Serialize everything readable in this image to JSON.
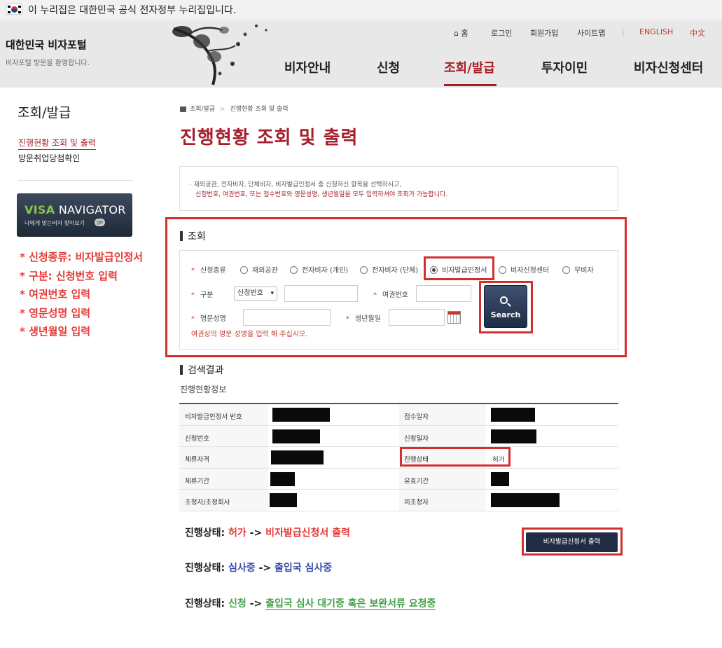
{
  "gov_bar": {
    "text": "이 누리집은 대한민국 공식 전자정부 누리집입니다."
  },
  "header": {
    "brand": "대한민국 비자포털",
    "brand_sub": "비자포털 방문을 환영합니다.",
    "utility": [
      "홈",
      "로그인",
      "회원가입",
      "사이트맵",
      "ENGLISH",
      "中文"
    ],
    "nav": [
      "비자안내",
      "신청",
      "조회/발급",
      "투자이민",
      "비자신청센터"
    ],
    "active_nav": "조회/발급"
  },
  "sidebar": {
    "title": "조회/발급",
    "items": [
      "진행현황 조회 및 출력",
      "방문취업당첨확인"
    ],
    "banner": {
      "title_a": "VISA",
      "title_b": " NAVIGATOR",
      "sub": "나에게 맞는비자 찾아보기",
      "go": "go"
    }
  },
  "annotations": [
    "* 신청종류: 비자발급인정서",
    "* 구분: 신청번호 입력",
    "* 여권번호 입력",
    "* 영문성명 입력",
    "* 생년월일 입력"
  ],
  "breadcrumb": [
    "조회/발급",
    ">",
    "진행현황 조회 및 출력"
  ],
  "page_title": "진행현황 조회 및 출력",
  "notice": {
    "line1": "· 재외공관, 전자비자, 단체비자, 비자발급인정서 중 신청하신 항목을 선택하시고,",
    "line2": "신청번호, 여권번호, 또는 접수번호와 영문성명, 생년월일을 모두 입력하셔야 조회가 가능합니다."
  },
  "search": {
    "heading": "조회",
    "type_label": "신청종류",
    "types": [
      "재외공관",
      "전자비자 (개인)",
      "전자비자 (단체)",
      "비자발급인정서",
      "비자신청센터",
      "무비자"
    ],
    "selected_type": "비자발급인정서",
    "category_label": "구분",
    "category_value": "신청번호",
    "passport_label": "여권번호",
    "name_label": "영문성명",
    "birth_label": "생년월일",
    "hint": "여권상의 영문 성명을 입력 해 주십시오.",
    "button": "Search"
  },
  "results": {
    "heading": "검색결과",
    "subheading": "진행현황정보",
    "rows": [
      {
        "k1": "비자발급인정서 번호",
        "k2": "접수일자",
        "v2": ""
      },
      {
        "k1": "신청번호",
        "k2": "신청일자",
        "v2": ""
      },
      {
        "k1": "체류자격",
        "k2": "진행상태",
        "v2": "허가"
      },
      {
        "k1": "체류기간",
        "k2": "유효기간",
        "v2": ""
      },
      {
        "k1": "초청자/초청회사",
        "k2": "피초청자",
        "v2": ""
      }
    ]
  },
  "status_notes": {
    "prefix": "진행상태:",
    "arrow": "->",
    "line1": {
      "status": "허가",
      "action": "비자발급신청서 출력"
    },
    "line2": {
      "status": "심사중",
      "action": "출입국 심사중"
    },
    "line3": {
      "status": "신청",
      "action": "출입국 심사 대기중 혹은 보완서류 요청중"
    }
  },
  "print_button": "비자발급신청서 출력",
  "colors": {
    "brand_red": "#a61e2a",
    "annotation_red": "#e53935",
    "navy": "#1f2c44",
    "blue": "#3949ab",
    "green": "#43a047"
  }
}
